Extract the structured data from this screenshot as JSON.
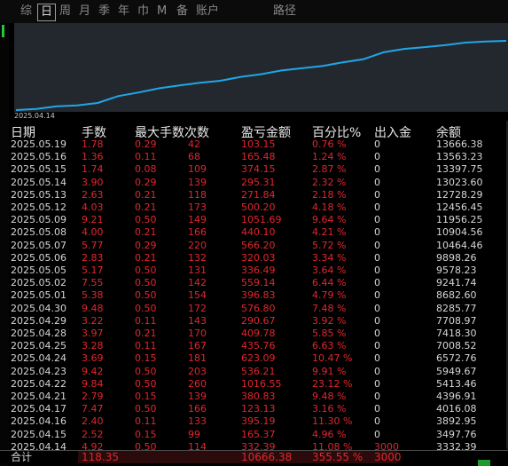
{
  "tabs": [
    {
      "label": "综",
      "active": false
    },
    {
      "label": "日",
      "active": true
    },
    {
      "label": "周",
      "active": false
    },
    {
      "label": "月",
      "active": false
    },
    {
      "label": "季",
      "active": false
    },
    {
      "label": "年",
      "active": false
    },
    {
      "label": "巾",
      "active": false
    },
    {
      "label": "M",
      "active": false
    },
    {
      "label": "备",
      "active": false
    },
    {
      "label": "账户",
      "active": false
    },
    {
      "label": "路径",
      "active": false
    }
  ],
  "chart": {
    "start_date": "2025.04.14",
    "line_color": "#1fa7e8",
    "bg_color": "#23282e",
    "values": [
      3332.39,
      3497.76,
      3892.95,
      4016.08,
      4396.91,
      5413.46,
      5949.67,
      6572.76,
      7008.52,
      7418.3,
      7708.97,
      8285.77,
      8682.6,
      9241.74,
      9578.23,
      9898.26,
      10464.46,
      10904.56,
      11956.25,
      12456.45,
      12728.29,
      13023.6,
      13397.75,
      13563.23,
      13666.38
    ]
  },
  "table": {
    "headers": {
      "date": "日期",
      "lots": "手数",
      "max_lots": "最大手数",
      "count": "次数",
      "pnl": "盈亏金额",
      "pct": "百分比%",
      "flow": "出入金",
      "balance": "余额"
    },
    "rows": [
      {
        "date": "2025.05.19",
        "lots": "1.78",
        "max_lots": "0.29",
        "count": "42",
        "pnl": "103.15",
        "pct": "0.76 %",
        "flow": "0",
        "balance": "13666.38"
      },
      {
        "date": "2025.05.16",
        "lots": "1.36",
        "max_lots": "0.11",
        "count": "68",
        "pnl": "165.48",
        "pct": "1.24 %",
        "flow": "0",
        "balance": "13563.23"
      },
      {
        "date": "2025.05.15",
        "lots": "1.74",
        "max_lots": "0.08",
        "count": "109",
        "pnl": "374.15",
        "pct": "2.87 %",
        "flow": "0",
        "balance": "13397.75"
      },
      {
        "date": "2025.05.14",
        "lots": "3.90",
        "max_lots": "0.29",
        "count": "139",
        "pnl": "295.31",
        "pct": "2.32 %",
        "flow": "0",
        "balance": "13023.60"
      },
      {
        "date": "2025.05.13",
        "lots": "2.63",
        "max_lots": "0.21",
        "count": "118",
        "pnl": "271.84",
        "pct": "2.18 %",
        "flow": "0",
        "balance": "12728.29"
      },
      {
        "date": "2025.05.12",
        "lots": "4.03",
        "max_lots": "0.21",
        "count": "173",
        "pnl": "500.20",
        "pct": "4.18 %",
        "flow": "0",
        "balance": "12456.45"
      },
      {
        "date": "2025.05.09",
        "lots": "9.21",
        "max_lots": "0.50",
        "count": "149",
        "pnl": "1051.69",
        "pct": "9.64 %",
        "flow": "0",
        "balance": "11956.25"
      },
      {
        "date": "2025.05.08",
        "lots": "4.00",
        "max_lots": "0.21",
        "count": "166",
        "pnl": "440.10",
        "pct": "4.21 %",
        "flow": "0",
        "balance": "10904.56"
      },
      {
        "date": "2025.05.07",
        "lots": "5.77",
        "max_lots": "0.29",
        "count": "220",
        "pnl": "566.20",
        "pct": "5.72 %",
        "flow": "0",
        "balance": "10464.46"
      },
      {
        "date": "2025.05.06",
        "lots": "2.83",
        "max_lots": "0.21",
        "count": "132",
        "pnl": "320.03",
        "pct": "3.34 %",
        "flow": "0",
        "balance": "9898.26"
      },
      {
        "date": "2025.05.05",
        "lots": "5.17",
        "max_lots": "0.50",
        "count": "131",
        "pnl": "336.49",
        "pct": "3.64 %",
        "flow": "0",
        "balance": "9578.23"
      },
      {
        "date": "2025.05.02",
        "lots": "7.55",
        "max_lots": "0.50",
        "count": "142",
        "pnl": "559.14",
        "pct": "6.44 %",
        "flow": "0",
        "balance": "9241.74"
      },
      {
        "date": "2025.05.01",
        "lots": "5.38",
        "max_lots": "0.50",
        "count": "154",
        "pnl": "396.83",
        "pct": "4.79 %",
        "flow": "0",
        "balance": "8682.60"
      },
      {
        "date": "2025.04.30",
        "lots": "9.48",
        "max_lots": "0.50",
        "count": "172",
        "pnl": "576.80",
        "pct": "7.48 %",
        "flow": "0",
        "balance": "8285.77"
      },
      {
        "date": "2025.04.29",
        "lots": "3.22",
        "max_lots": "0.11",
        "count": "143",
        "pnl": "290.67",
        "pct": "3.92 %",
        "flow": "0",
        "balance": "7708.97"
      },
      {
        "date": "2025.04.28",
        "lots": "3.97",
        "max_lots": "0.21",
        "count": "170",
        "pnl": "409.78",
        "pct": "5.85 %",
        "flow": "0",
        "balance": "7418.30"
      },
      {
        "date": "2025.04.25",
        "lots": "3.28",
        "max_lots": "0.11",
        "count": "167",
        "pnl": "435.76",
        "pct": "6.63 %",
        "flow": "0",
        "balance": "7008.52"
      },
      {
        "date": "2025.04.24",
        "lots": "3.69",
        "max_lots": "0.15",
        "count": "181",
        "pnl": "623.09",
        "pct": "10.47 %",
        "flow": "0",
        "balance": "6572.76"
      },
      {
        "date": "2025.04.23",
        "lots": "9.42",
        "max_lots": "0.50",
        "count": "203",
        "pnl": "536.21",
        "pct": "9.91 %",
        "flow": "0",
        "balance": "5949.67"
      },
      {
        "date": "2025.04.22",
        "lots": "9.84",
        "max_lots": "0.50",
        "count": "260",
        "pnl": "1016.55",
        "pct": "23.12 %",
        "flow": "0",
        "balance": "5413.46"
      },
      {
        "date": "2025.04.21",
        "lots": "2.79",
        "max_lots": "0.15",
        "count": "139",
        "pnl": "380.83",
        "pct": "9.48 %",
        "flow": "0",
        "balance": "4396.91"
      },
      {
        "date": "2025.04.17",
        "lots": "7.47",
        "max_lots": "0.50",
        "count": "166",
        "pnl": "123.13",
        "pct": "3.16 %",
        "flow": "0",
        "balance": "4016.08"
      },
      {
        "date": "2025.04.16",
        "lots": "2.40",
        "max_lots": "0.11",
        "count": "133",
        "pnl": "395.19",
        "pct": "11.30 %",
        "flow": "0",
        "balance": "3892.95"
      },
      {
        "date": "2025.04.15",
        "lots": "2.52",
        "max_lots": "0.15",
        "count": "99",
        "pnl": "165.37",
        "pct": "4.96 %",
        "flow": "0",
        "balance": "3497.76"
      },
      {
        "date": "2025.04.14",
        "lots": "4.92",
        "max_lots": "0.50",
        "count": "114",
        "pnl": "332.39",
        "pct": "11.08 %",
        "flow": "3000",
        "balance": "3332.39"
      }
    ],
    "total": {
      "label": "合计",
      "lots": "118.35",
      "pnl": "10666.38",
      "pct": "355.55 %",
      "flow": "3000"
    }
  },
  "colors": {
    "negative_value": "#e2262d",
    "text": "#d6d6d6",
    "background": "#000000",
    "accent_green": "#27c63a"
  }
}
